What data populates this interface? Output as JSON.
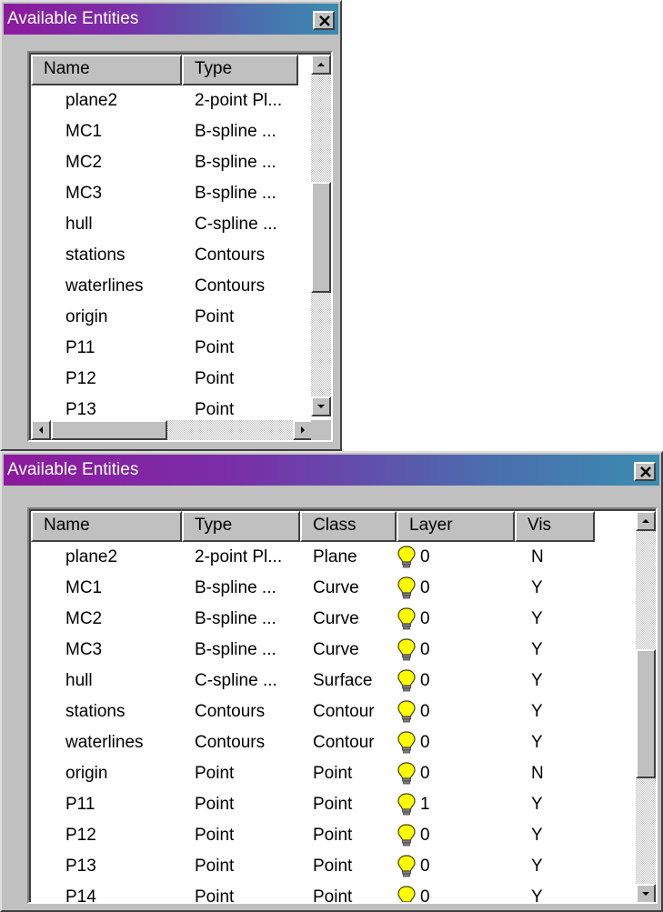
{
  "windows": [
    {
      "title": "Available Entities",
      "columns": [
        "Name",
        "Type"
      ],
      "rows": [
        {
          "name": "plane2",
          "type": "2-point Pl..."
        },
        {
          "name": "MC1",
          "type": "B-spline ..."
        },
        {
          "name": "MC2",
          "type": "B-spline ..."
        },
        {
          "name": "MC3",
          "type": "B-spline ..."
        },
        {
          "name": "hull",
          "type": "C-spline ..."
        },
        {
          "name": "stations",
          "type": "Contours"
        },
        {
          "name": "waterlines",
          "type": "Contours"
        },
        {
          "name": "origin",
          "type": "Point"
        },
        {
          "name": "P11",
          "type": "Point"
        },
        {
          "name": "P12",
          "type": "Point"
        },
        {
          "name": "P13",
          "type": "Point"
        }
      ]
    },
    {
      "title": "Available Entities",
      "columns": [
        "Name",
        "Type",
        "Class",
        "Layer",
        "Vis"
      ],
      "rows": [
        {
          "name": "plane2",
          "type": "2-point Pl...",
          "class": "Plane",
          "layer": "0",
          "vis": "N"
        },
        {
          "name": "MC1",
          "type": "B-spline ...",
          "class": "Curve",
          "layer": "0",
          "vis": "Y"
        },
        {
          "name": "MC2",
          "type": "B-spline ...",
          "class": "Curve",
          "layer": "0",
          "vis": "Y"
        },
        {
          "name": "MC3",
          "type": "B-spline ...",
          "class": "Curve",
          "layer": "0",
          "vis": "Y"
        },
        {
          "name": "hull",
          "type": "C-spline ...",
          "class": "Surface",
          "layer": "0",
          "vis": "Y"
        },
        {
          "name": "stations",
          "type": "Contours",
          "class": "Contour",
          "layer": "0",
          "vis": "Y"
        },
        {
          "name": "waterlines",
          "type": "Contours",
          "class": "Contour",
          "layer": "0",
          "vis": "Y"
        },
        {
          "name": "origin",
          "type": "Point",
          "class": "Point",
          "layer": "0",
          "vis": "N"
        },
        {
          "name": "P11",
          "type": "Point",
          "class": "Point",
          "layer": "1",
          "vis": "Y"
        },
        {
          "name": "P12",
          "type": "Point",
          "class": "Point",
          "layer": "0",
          "vis": "Y"
        },
        {
          "name": "P13",
          "type": "Point",
          "class": "Point",
          "layer": "0",
          "vis": "Y"
        },
        {
          "name": "P14",
          "type": "Point",
          "class": "Point",
          "layer": "0",
          "vis": "Y"
        }
      ]
    }
  ],
  "icons": {
    "layer": "lightbulb-icon",
    "close": "close-icon",
    "scroll_up": "arrow-up-icon",
    "scroll_down": "arrow-down-icon",
    "scroll_left": "arrow-left-icon",
    "scroll_right": "arrow-right-icon"
  },
  "colors": {
    "titlebar_start": "#8c1a9c",
    "titlebar_end": "#3a8cb0",
    "bulb": "#ffff00"
  }
}
